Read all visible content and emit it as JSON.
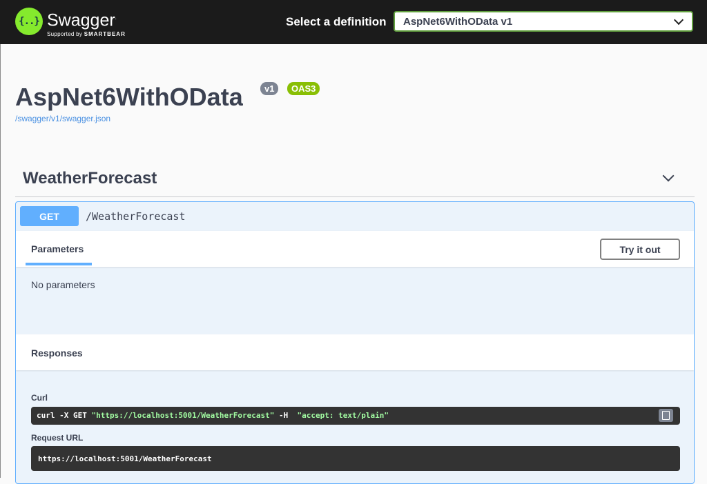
{
  "header": {
    "logo_glyph": "{..}",
    "brand_name": "Swagger",
    "brand_trademark": ".",
    "brand_sub_prefix": "Supported by",
    "brand_sub_company": "SMARTBEAR",
    "select_label": "Select a definition",
    "selected_definition": "AspNet6WithOData v1"
  },
  "info": {
    "title": "AspNet6WithOData",
    "version_badge": "v1",
    "oas_badge": "OAS3",
    "spec_url": "/swagger/v1/swagger.json"
  },
  "tag": {
    "name": "WeatherForecast"
  },
  "operation": {
    "method": "GET",
    "path": "/WeatherForecast",
    "parameters_tab": "Parameters",
    "try_button": "Try it out",
    "no_parameters": "No parameters",
    "responses_title": "Responses",
    "curl_label": "Curl",
    "curl_cmd_prefix": "curl -X GET ",
    "curl_url": "\"https://localhost:5001/WeatherForecast\"",
    "curl_flag": " -H  ",
    "curl_header": "\"accept: text/plain\"",
    "request_url_label": "Request URL",
    "request_url": "https://localhost:5001/WeatherForecast"
  },
  "colors": {
    "topbar": "#1b1b1b",
    "logo_green": "#85ea2d",
    "get_blue": "#61affe",
    "oas_green": "#89bf04",
    "version_gray": "#7d8492",
    "code_bg": "#333333"
  },
  "icons": [
    "swagger-logo-icon",
    "chevron-down-icon",
    "copy-icon"
  ]
}
